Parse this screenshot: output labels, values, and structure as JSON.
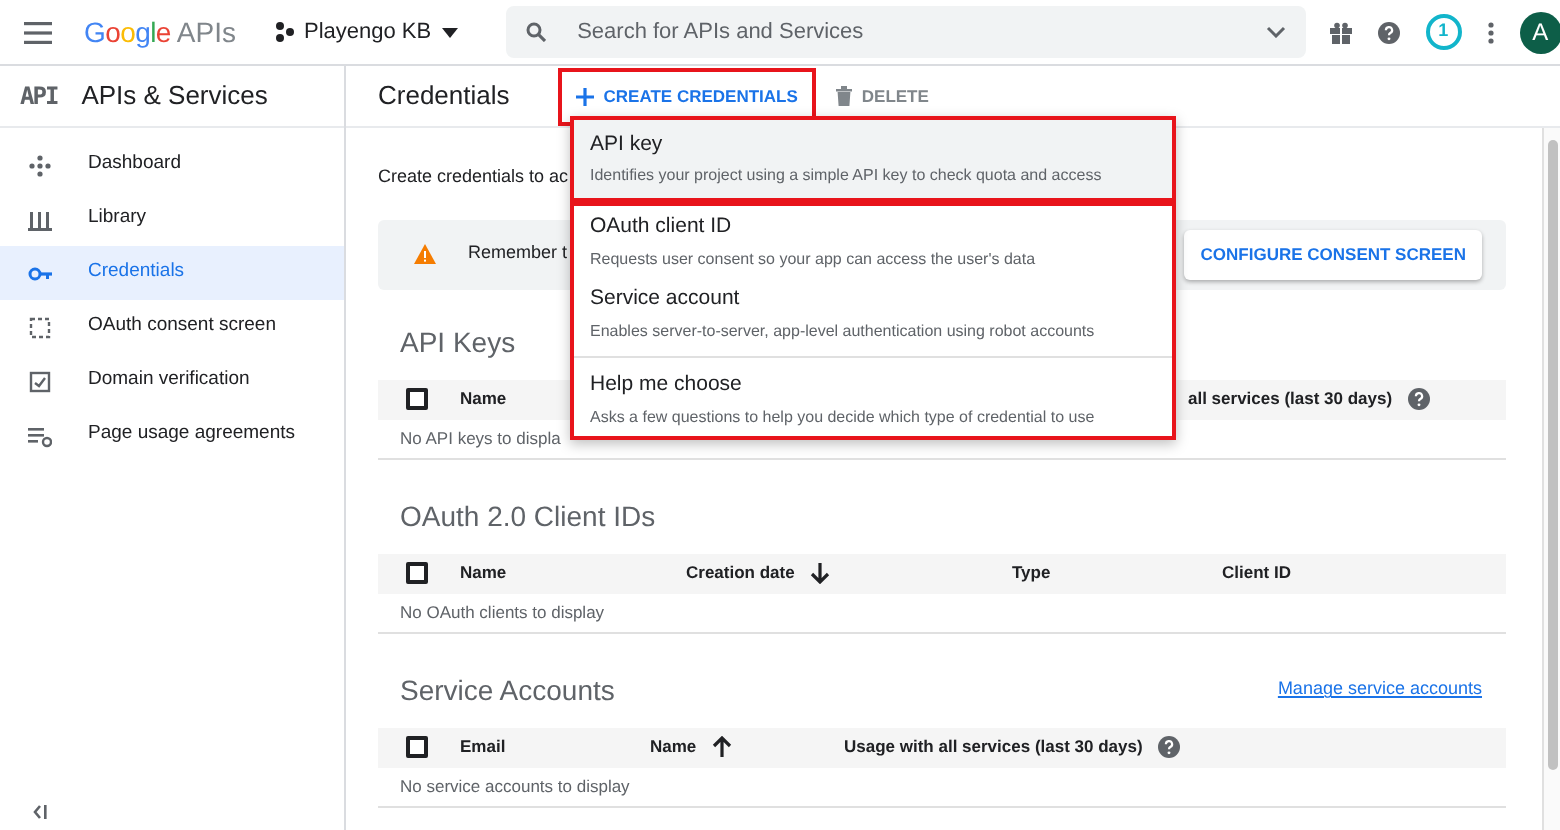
{
  "topbar": {
    "logo_brand": "Google",
    "logo_product": "APIs",
    "project": "Playengo KB",
    "search": {
      "placeholder": "Search for APIs and Services"
    },
    "notification_count": "1",
    "avatar": "A"
  },
  "sidebar": {
    "logo": "API",
    "title": "APIs & Services",
    "items": [
      {
        "label": "Dashboard",
        "selected": false
      },
      {
        "label": "Library",
        "selected": false
      },
      {
        "label": "Credentials",
        "selected": true
      },
      {
        "label": "OAuth consent screen",
        "selected": false
      },
      {
        "label": "Domain verification",
        "selected": false
      },
      {
        "label": "Page usage agreements",
        "selected": false
      }
    ]
  },
  "page": {
    "title": "Credentials",
    "create_button": {
      "label": "CREATE CREDENTIALS",
      "annotated": true
    },
    "delete_button": "DELETE"
  },
  "intro": "Create credentials to ac",
  "notice": {
    "text": "Remember t",
    "button": "CONFIGURE CONSENT SCREEN"
  },
  "api_keys": {
    "title": "API Keys",
    "checked": false,
    "columns": [
      "Name",
      "all services (last 30 days)"
    ],
    "empty": "No API keys to displa"
  },
  "oauth": {
    "title": "OAuth 2.0 Client IDs",
    "checked": false,
    "columns": [
      "Name",
      "Creation date",
      "Type",
      "Client ID"
    ],
    "empty": "No OAuth clients to display"
  },
  "service_accounts": {
    "title": "Service Accounts",
    "checked": false,
    "link": "Manage service accounts",
    "columns": [
      "Email",
      "Name",
      "Usage with all services (last 30 days)"
    ],
    "empty": "No service accounts to display"
  },
  "menu": {
    "groups": [
      {
        "annotated": true,
        "items": [
          {
            "title": "API key",
            "description": "Identifies your project using a simple API key to check quota and access",
            "hovered": true
          }
        ]
      },
      {
        "annotated": true,
        "items": [
          {
            "title": "OAuth client ID",
            "description": "Requests user consent so your app can access the user's data",
            "hovered": false
          },
          {
            "title": "Service account",
            "description": "Enables server-to-server, app-level authentication using robot accounts",
            "hovered": false
          },
          {
            "title": "Help me choose",
            "description": "Asks a few questions to help you decide which type of credential to use",
            "hovered": false,
            "divider_before": true
          }
        ]
      }
    ]
  }
}
